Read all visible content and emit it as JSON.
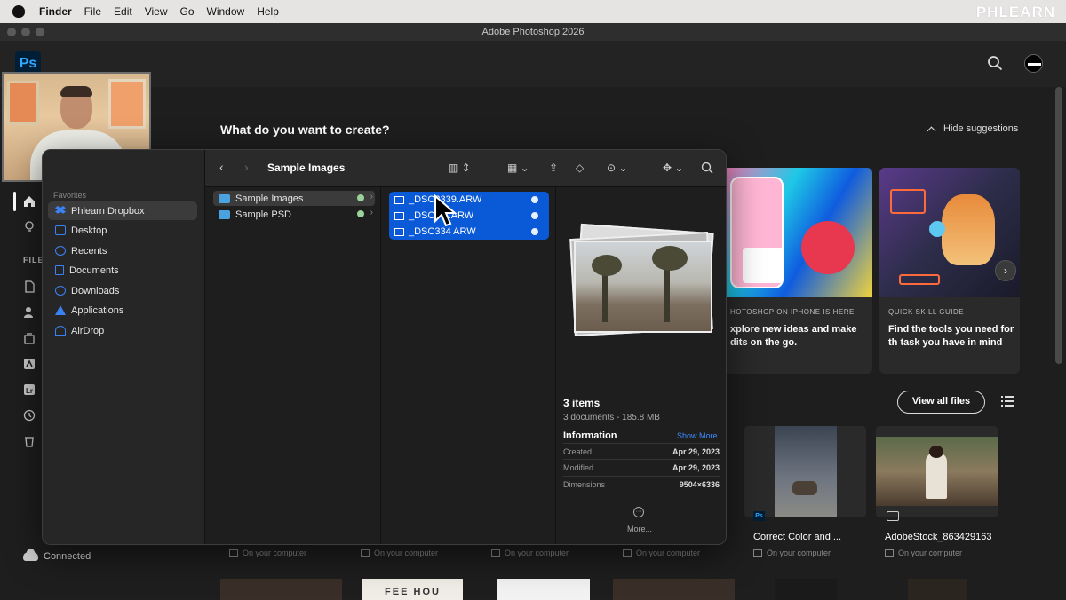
{
  "menubar": {
    "app": "Finder",
    "items": [
      "File",
      "Edit",
      "View",
      "Go",
      "Window",
      "Help"
    ],
    "brand": "PHLEARN"
  },
  "window": {
    "title": "Adobe Photoshop 2026"
  },
  "ps": {
    "logo": "Ps",
    "heading": "What do you want to create?",
    "hide_suggestions": "Hide suggestions",
    "files_label": "FILES",
    "connected": "Connected",
    "cards": [
      {
        "caption": "HOTOSHOP ON IPHONE IS HERE",
        "desc": "xplore new ideas and make dits on the go."
      },
      {
        "caption": "QUICK SKILL GUIDE",
        "desc": "Find the tools you need for th task you have in mind"
      }
    ],
    "view_all": "View all files",
    "files": [
      {
        "name": "Correct Color and ...",
        "location": "On your computer"
      },
      {
        "name": "AdobeStock_863429163",
        "location": "On your computer"
      }
    ],
    "hidden_locations": [
      "On your computer",
      "On your computer",
      "On your computer",
      "On your computer"
    ],
    "thumb_text": "FEE HOU"
  },
  "finder": {
    "title": "Sample Images",
    "favorites_label": "Favorites",
    "sidebar": [
      "Phlearn Dropbox",
      "Desktop",
      "Recents",
      "Documents",
      "Downloads",
      "Applications",
      "AirDrop"
    ],
    "folders": [
      "Sample Images",
      "Sample PSD"
    ],
    "files": [
      "_DSC3339.ARW",
      "_DSC33 .ARW",
      "_DSC334 ARW"
    ],
    "preview": {
      "count": "3 items",
      "summary": "3 documents - 185.8 MB",
      "info_label": "Information",
      "show_more": "Show More",
      "rows": [
        {
          "k": "Created",
          "v": "Apr 29, 2023"
        },
        {
          "k": "Modified",
          "v": "Apr 29, 2023"
        },
        {
          "k": "Dimensions",
          "v": "9504×6336"
        }
      ],
      "more": "More..."
    }
  }
}
